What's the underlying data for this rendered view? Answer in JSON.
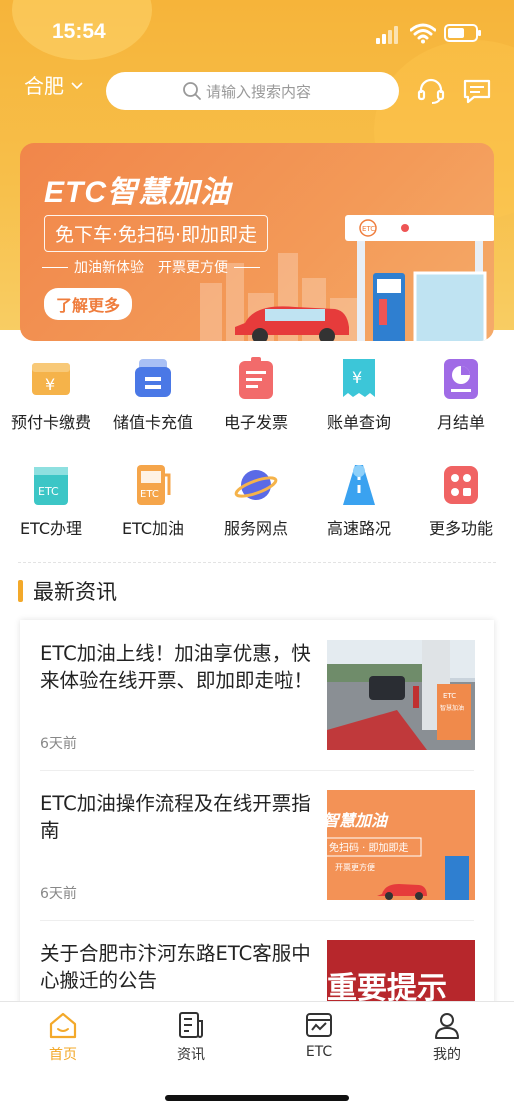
{
  "status_bar": {
    "time": "15:54"
  },
  "header": {
    "city": "合肥",
    "search_placeholder": "请输入搜索内容",
    "icons": [
      "headset-icon",
      "message-icon"
    ]
  },
  "banner": {
    "title": "ETC智慧加油",
    "slogan": "免下车·免扫码·即加即走",
    "subline_left": "加油新体验",
    "subline_right": "开票更方便",
    "button": "了解更多"
  },
  "services": [
    {
      "label": "预付卡缴费",
      "icon": "prepaid-card-icon",
      "color": "#f5b34a"
    },
    {
      "label": "储值卡充值",
      "icon": "stored-card-icon",
      "color": "#4a78e6"
    },
    {
      "label": "电子发票",
      "icon": "invoice-icon",
      "color": "#f26b6b"
    },
    {
      "label": "账单查询",
      "icon": "bill-icon",
      "color": "#3cc6d8"
    },
    {
      "label": "月结单",
      "icon": "monthly-statement-icon",
      "color": "#a06be6"
    },
    {
      "label": "ETC办理",
      "icon": "etc-card-icon",
      "color": "#3cc6c6"
    },
    {
      "label": "ETC加油",
      "icon": "fuel-pump-icon",
      "color": "#f5a54a"
    },
    {
      "label": "服务网点",
      "icon": "planet-icon",
      "color": "#5a6ae6"
    },
    {
      "label": "高速路况",
      "icon": "road-icon",
      "color": "#3aa2f0"
    },
    {
      "label": "更多功能",
      "icon": "more-icon",
      "color": "#f06363"
    }
  ],
  "icon_badges": {
    "yen": "¥",
    "etc": "ETC"
  },
  "news": {
    "heading": "最新资讯",
    "items": [
      {
        "title": "ETC加油上线！加油享优惠，快来体验在线开票、即加即走啦！",
        "date": "6天前",
        "thumb": "gas-station-photo"
      },
      {
        "title": "ETC加油操作流程及在线开票指南",
        "date": "6天前",
        "thumb": "etc-fuel-banner",
        "thumb_title": "智慧加油",
        "thumb_slogan": "免扫码 · 即加即走",
        "thumb_sub": "开票更方便"
      },
      {
        "title": "关于合肥市汴河东路ETC客服中心搬迁的公告",
        "date": "",
        "thumb": "important-notice",
        "thumb_text": "重要提示"
      }
    ],
    "photo_text": {
      "sign_line1": "ETC",
      "sign_line2": "智慧加油"
    }
  },
  "tabbar": [
    {
      "label": "首页",
      "icon": "home-icon",
      "active": true
    },
    {
      "label": "资讯",
      "icon": "news-icon",
      "active": false
    },
    {
      "label": "ETC",
      "icon": "etc-tab-icon",
      "active": false
    },
    {
      "label": "我的",
      "icon": "profile-icon",
      "active": false
    }
  ],
  "colors": {
    "accent": "#f3a92a",
    "banner": "#f1864a",
    "header": "#f6b43a"
  }
}
